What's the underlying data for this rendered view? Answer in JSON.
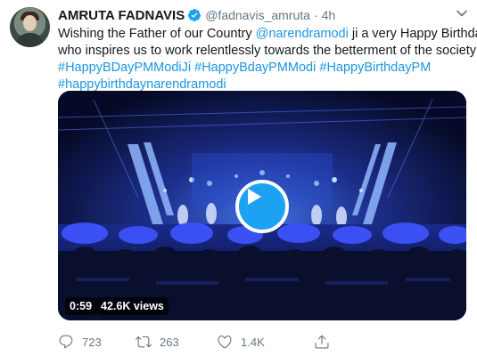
{
  "tweet": {
    "author": {
      "name": "AMRUTA FADNAVIS",
      "handle": "@fadnavis_amruta",
      "separator": "·",
      "time": "4h",
      "verified": true
    },
    "text": {
      "line1_pre": "Wishing the Father of our Country ",
      "line1_mention": "@narendramodi",
      "line1_post": " ji a very Happy Birthday -",
      "line2": "who inspires us to work relentlessly towards the betterment of the society !",
      "hashtags_line3": [
        "#HappyBDayPMModiJi",
        "#HappyBdayPMModi",
        "#HappyBirthdayPM"
      ],
      "hashtags_line4": [
        "#happybirthdaynarendramodi"
      ]
    },
    "media": {
      "duration": "0:59",
      "views": "42.6K views"
    },
    "actions": {
      "replies": "723",
      "retweets": "263",
      "likes": "1.4K"
    },
    "colors": {
      "link": "#1b95e0",
      "accent": "#1da1f2",
      "muted": "#657786"
    },
    "icons": [
      "verified-badge-icon",
      "chevron-down-icon",
      "play-icon",
      "reply-icon",
      "retweet-icon",
      "like-icon",
      "share-icon"
    ]
  }
}
